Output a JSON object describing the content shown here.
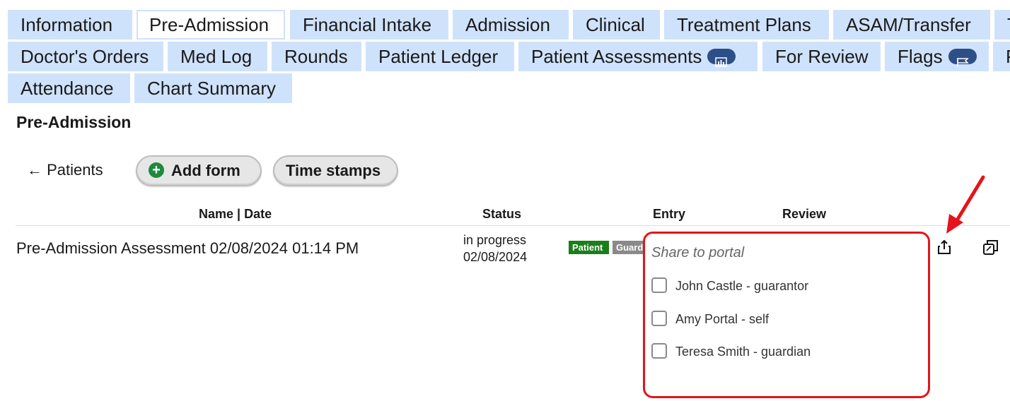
{
  "tabs": {
    "row1": [
      {
        "label": "Information",
        "active": false
      },
      {
        "label": "Pre-Admission",
        "active": true
      },
      {
        "label": "Financial Intake",
        "active": false
      },
      {
        "label": "Admission",
        "active": false
      },
      {
        "label": "Clinical",
        "active": false
      },
      {
        "label": "Treatment Plans",
        "active": false
      },
      {
        "label": "ASAM/Transfer",
        "active": false
      },
      {
        "label": "T",
        "active": false
      }
    ],
    "row2": [
      {
        "label": "Doctor's Orders"
      },
      {
        "label": "Med Log"
      },
      {
        "label": "Rounds"
      },
      {
        "label": "Patient Ledger"
      },
      {
        "label": "Patient Assessments",
        "icon": "bar-chart-icon"
      },
      {
        "label": "For Review"
      },
      {
        "label": "Flags",
        "icon": "flag-icon"
      },
      {
        "label": "P"
      }
    ],
    "row3": [
      {
        "label": "Attendance"
      },
      {
        "label": "Chart Summary"
      }
    ]
  },
  "page": {
    "title": "Pre-Admission",
    "back_link": "← Patients",
    "add_form_label": "Add form",
    "time_stamps_label": "Time stamps"
  },
  "table": {
    "headers": {
      "name_date": "Name | Date",
      "status": "Status",
      "entry": "Entry",
      "review": "Review"
    },
    "rows": [
      {
        "name": "Pre-Admission Assessment 02/08/2024 01:14 PM",
        "status": "in progress",
        "status_date": "02/08/2024",
        "badges": [
          {
            "label": "Patient",
            "color": "#1a7f1a"
          },
          {
            "label": "Guardian",
            "color": "#8a8a8a"
          }
        ]
      }
    ]
  },
  "share_popup": {
    "title": "Share to portal",
    "options": [
      {
        "label": "John Castle - guarantor",
        "checked": false
      },
      {
        "label": "Amy Portal - self",
        "checked": false
      },
      {
        "label": "Teresa Smith - guardian",
        "checked": false
      }
    ],
    "border_color": "#e3151a"
  },
  "colors": {
    "tab_bg": "#cfe2fb",
    "tab_icon_bg": "#2d4f87",
    "add_icon": "#1f8a3c",
    "annotation_arrow": "#e3151a"
  },
  "icons": {
    "share": "share-icon",
    "copy": "copy-icon"
  }
}
